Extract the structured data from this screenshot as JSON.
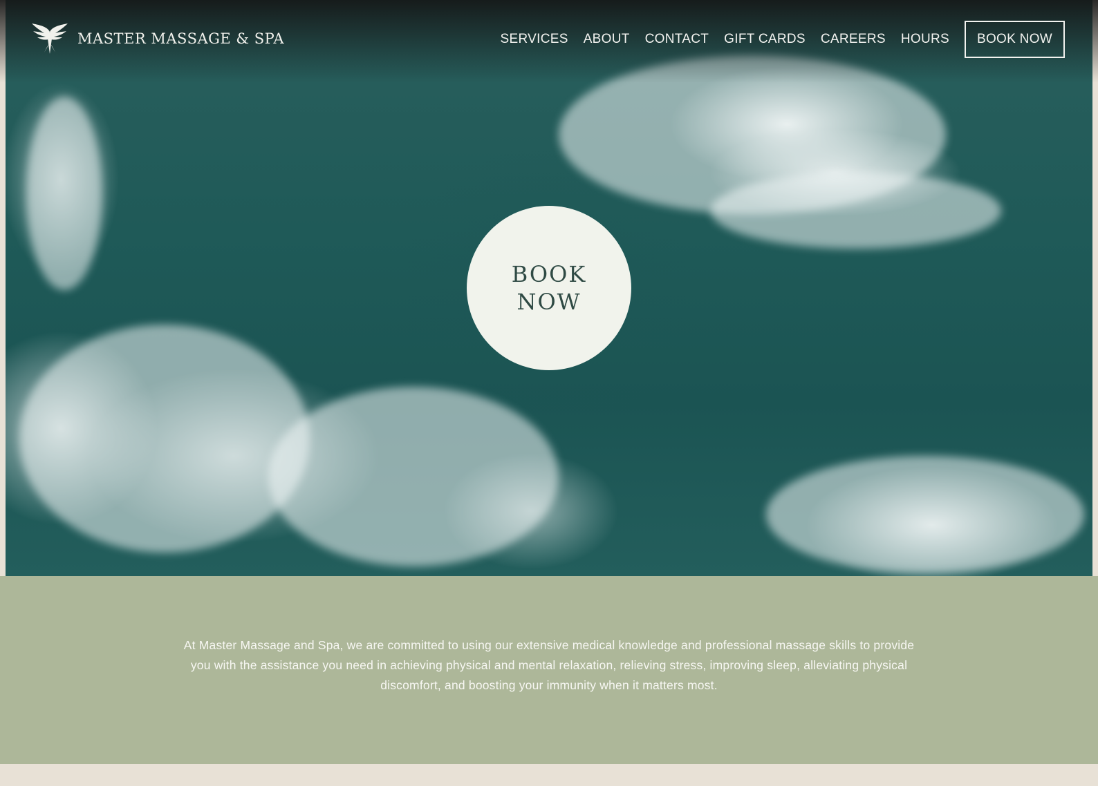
{
  "brand": {
    "name": "MASTER MASSAGE & SPA",
    "logo_icon": "phoenix-icon"
  },
  "nav": {
    "items": [
      {
        "label": "SERVICES"
      },
      {
        "label": "ABOUT"
      },
      {
        "label": "CONTACT"
      },
      {
        "label": "GIFT CARDS"
      },
      {
        "label": "CAREERS"
      },
      {
        "label": "HOURS"
      }
    ],
    "book_label": "BOOK NOW"
  },
  "hero": {
    "cta_line1": "BOOK",
    "cta_line2": "NOW"
  },
  "intro": {
    "text": "At Master Massage and Spa, we are committed to using our extensive medical knowledge and professional massage skills to provide you with the assistance you need in achieving physical and mental relaxation, relieving stress, improving sleep, alleviating physical discomfort, and boosting your immunity when it matters most."
  },
  "colors": {
    "sea": "#1f5a58",
    "sage_band": "#adb799",
    "cream": "#e8e1d6",
    "circle": "#f1f3ec"
  }
}
